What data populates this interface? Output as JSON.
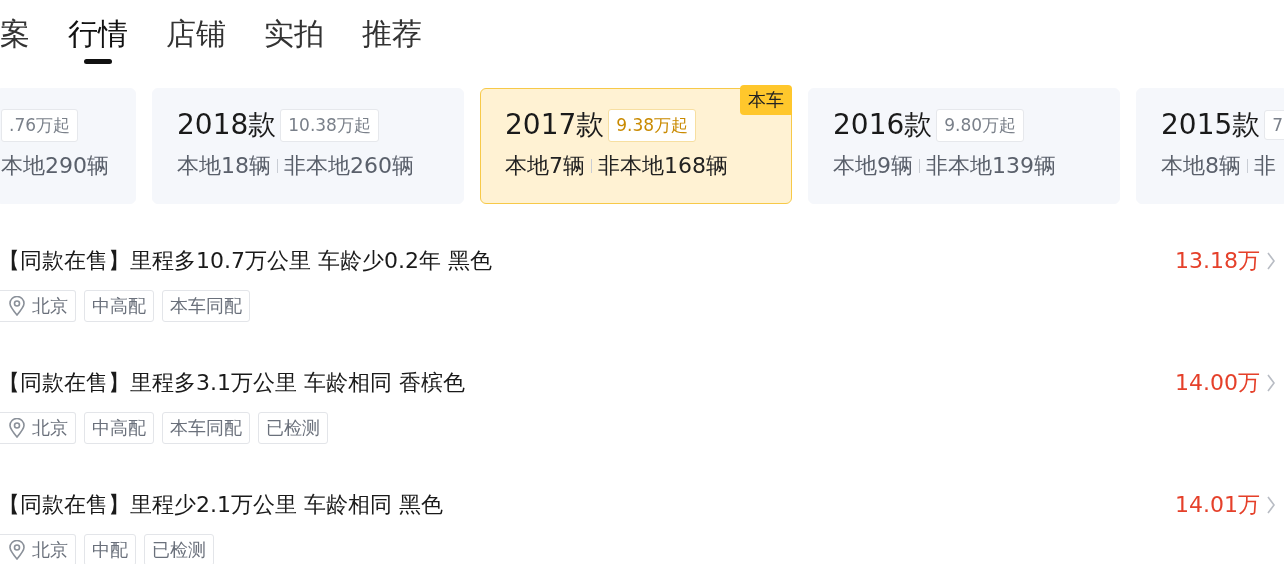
{
  "tabs": [
    {
      "label": "案",
      "selected": false
    },
    {
      "label": "行情",
      "selected": true
    },
    {
      "label": "店铺",
      "selected": false
    },
    {
      "label": "实拍",
      "selected": false
    },
    {
      "label": "推荐",
      "selected": false
    }
  ],
  "year_cards": [
    {
      "price": ".76万起",
      "local": "本地290辆",
      "selected": false
    },
    {
      "year": "2018款",
      "price": "10.38万起",
      "local": "本地18辆",
      "nonlocal": "非本地260辆",
      "selected": false
    },
    {
      "year": "2017款",
      "price": "9.38万起",
      "local": "本地7辆",
      "nonlocal": "非本地168辆",
      "selected": true,
      "badge": "本车"
    },
    {
      "year": "2016款",
      "price": "9.80万起",
      "local": "本地9辆",
      "nonlocal": "非本地139辆",
      "selected": false
    },
    {
      "year": "2015款",
      "price": "7",
      "local": "本地8辆",
      "nonlocal": "非",
      "selected": false
    }
  ],
  "listings": [
    {
      "title": "【同款在售】里程多10.7万公里 车龄少0.2年 黑色",
      "price": "13.18万",
      "tags": [
        {
          "kind": "location",
          "label": "北京"
        },
        {
          "kind": "plain",
          "label": "中高配"
        },
        {
          "kind": "plain",
          "label": "本车同配"
        }
      ]
    },
    {
      "title": "【同款在售】里程多3.1万公里 车龄相同 香槟色",
      "price": "14.00万",
      "tags": [
        {
          "kind": "location",
          "label": "北京"
        },
        {
          "kind": "plain",
          "label": "中高配"
        },
        {
          "kind": "plain",
          "label": "本车同配"
        },
        {
          "kind": "plain",
          "label": "已检测"
        }
      ]
    },
    {
      "title": "【同款在售】里程少2.1万公里 车龄相同 黑色",
      "price": "14.01万",
      "tags": [
        {
          "kind": "location",
          "label": "北京"
        },
        {
          "kind": "plain",
          "label": "中配"
        },
        {
          "kind": "plain",
          "label": "已检测"
        }
      ]
    }
  ]
}
